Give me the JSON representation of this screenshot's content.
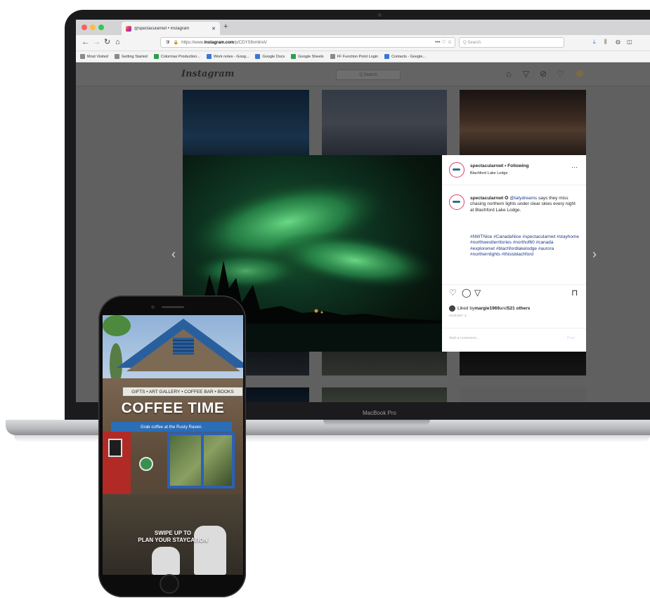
{
  "browser": {
    "tab_title": "@spectacularnwt • Instagram",
    "new_tab": "+",
    "url_prefix": "https://www.",
    "url_host": "instagram.com",
    "url_path": "/p/CDYS9vmlmA/",
    "url_tail": "••• ♡ ☆",
    "search_placeholder": "Q Search",
    "bookmarks": [
      {
        "label": "Most Visited",
        "color": "#8a8a8a"
      },
      {
        "label": "Getting Started",
        "color": "#8a8a8a"
      },
      {
        "label": "Colormax Production...",
        "color": "#2e9d4f"
      },
      {
        "label": "Work notes - Goog...",
        "color": "#3a76d8"
      },
      {
        "label": "Google Docs",
        "color": "#3a76d8"
      },
      {
        "label": "Google Sheets",
        "color": "#2e9d4f"
      },
      {
        "label": "FF Function Point Login",
        "color": "#8a8a8a"
      },
      {
        "label": "Contacts - Google...",
        "color": "#3a76d8"
      }
    ]
  },
  "instagram": {
    "logo": "Instagram",
    "search": "Q Search",
    "post": {
      "username_line": "spectacularnwt • Following",
      "location": "Blachford Lake Lodge",
      "more": "···",
      "caption_user": "spectacularnwt",
      "caption_mention": "@tatydreams",
      "caption_rest": " says they miss chasing northern lights under clear skies every night at Blachford Lake Lodge.",
      "hashtags": "#NWTNice #CanadaNice #spectacularnwt #stayhome #northwestterritories #northof60 #canada #explorenwt #blachfordlakelodge #aurora #northernlights #thisisblachford",
      "likes_prefix": "Liked by ",
      "likes_user": "margie1969",
      "likes_mid": " and ",
      "likes_count": "521 others",
      "date": "AUGUST 3",
      "comment_placeholder": "Add a comment...",
      "post_button": "Post"
    }
  },
  "laptop": {
    "label": "MacBook Pro"
  },
  "phone": {
    "sign": "GIFTS • ART GALLERY • COFFEE BAR • BOOKS",
    "title": "COFFEE TIME",
    "banner": "Grab coffee at the Rusty Raven.",
    "swipe_line1": "SWIPE UP TO",
    "swipe_line2": "PLAN YOUR STAYCATION"
  }
}
